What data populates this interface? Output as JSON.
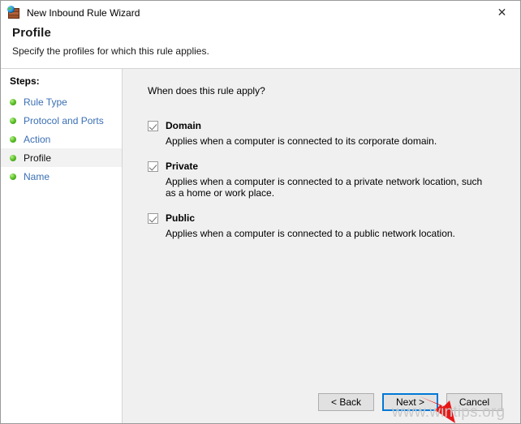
{
  "window": {
    "title": "New Inbound Rule Wizard",
    "title_icon": "firewall-globe-icon",
    "close_label": "✕"
  },
  "header": {
    "title": "Profile",
    "subtitle": "Specify the profiles for which this rule applies."
  },
  "sidebar": {
    "heading": "Steps:",
    "items": [
      {
        "label": "Rule Type",
        "current": false
      },
      {
        "label": "Protocol and Ports",
        "current": false
      },
      {
        "label": "Action",
        "current": false
      },
      {
        "label": "Profile",
        "current": true
      },
      {
        "label": "Name",
        "current": false
      }
    ]
  },
  "main": {
    "question": "When does this rule apply?",
    "options": [
      {
        "label": "Domain",
        "checked": true,
        "description": "Applies when a computer is connected to its corporate domain."
      },
      {
        "label": "Private",
        "checked": true,
        "description": "Applies when a computer is connected to a private network location, such as a home or work place."
      },
      {
        "label": "Public",
        "checked": true,
        "description": "Applies when a computer is connected to a public network location."
      }
    ]
  },
  "footer": {
    "back_label": "< Back",
    "next_label": "Next >",
    "cancel_label": "Cancel"
  },
  "annotations": {
    "watermark": "www.wintips.org",
    "arrow_color": "#e81717"
  },
  "colors": {
    "accent": "#0078d7",
    "link": "#3a6fb5",
    "panel": "#f0f0f0",
    "bullet": "#5fc12a"
  }
}
